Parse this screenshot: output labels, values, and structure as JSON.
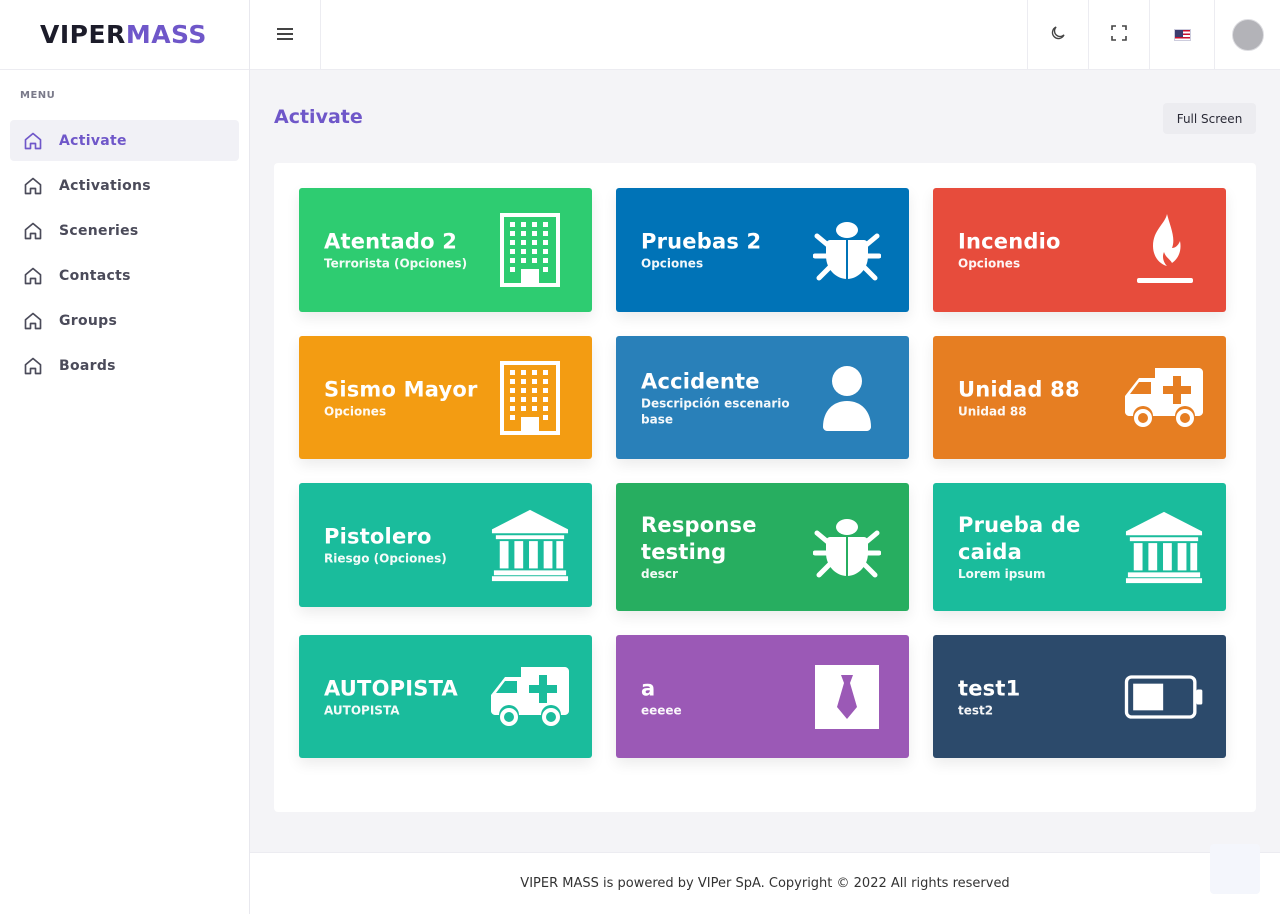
{
  "brand": {
    "part1": "VIPER",
    "part2": "MASS"
  },
  "sidebar": {
    "menu_title": "MENU",
    "items": [
      {
        "label": "Activate",
        "icon": "home-icon",
        "active": true
      },
      {
        "label": "Activations",
        "icon": "home-icon"
      },
      {
        "label": "Sceneries",
        "icon": "home-icon"
      },
      {
        "label": "Contacts",
        "icon": "home-icon"
      },
      {
        "label": "Groups",
        "icon": "home-icon"
      },
      {
        "label": "Boards",
        "icon": "home-icon"
      }
    ]
  },
  "header": {
    "menu_icon": "hamburger-icon",
    "theme_icon": "moon-icon",
    "fullscreen_icon": "expand-icon",
    "language_icon": "us-flag-icon",
    "avatar_icon": "user-avatar"
  },
  "page": {
    "title": "Activate",
    "fullscreen_label": "Full Screen"
  },
  "tiles": [
    {
      "title": "Atentado 2",
      "subtitle": "Terrorista (Opciones)",
      "icon": "building-icon",
      "color": "#2ecc71"
    },
    {
      "title": "Pruebas 2",
      "subtitle": "Opciones",
      "icon": "bug-icon",
      "color": "#0073b7"
    },
    {
      "title": "Incendio",
      "subtitle": "Opciones",
      "icon": "fire-icon",
      "color": "#e74c3c"
    },
    {
      "title": "Sismo Mayor",
      "subtitle": "Opciones",
      "icon": "building-icon",
      "color": "#f39c12"
    },
    {
      "title": "Accidente",
      "subtitle": "Descripción escenario base",
      "icon": "user-icon",
      "color": "#2980b9"
    },
    {
      "title": "Unidad 88",
      "subtitle": "Unidad 88",
      "icon": "ambulance-icon",
      "color": "#e67e22"
    },
    {
      "title": "Pistolero",
      "subtitle": "Riesgo (Opciones)",
      "icon": "bank-icon",
      "color": "#1abc9c"
    },
    {
      "title": "Response testing",
      "subtitle": "descr",
      "icon": "bug-icon",
      "color": "#27ae60"
    },
    {
      "title": "Prueba de caida",
      "subtitle": "Lorem ipsum",
      "icon": "bank-icon",
      "color": "#1abc9c"
    },
    {
      "title": "AUTOPISTA",
      "subtitle": "AUTOPISTA",
      "icon": "ambulance-icon",
      "color": "#1abc9c"
    },
    {
      "title": "a",
      "subtitle": "eeeee",
      "icon": "tie-icon",
      "color": "#9b59b6"
    },
    {
      "title": "test1",
      "subtitle": "test2",
      "icon": "battery-icon",
      "color": "#2c4a6b"
    }
  ],
  "footer": {
    "text": "VIPER MASS is powered by VIPer SpA. Copyright © 2022 All rights reserved"
  }
}
